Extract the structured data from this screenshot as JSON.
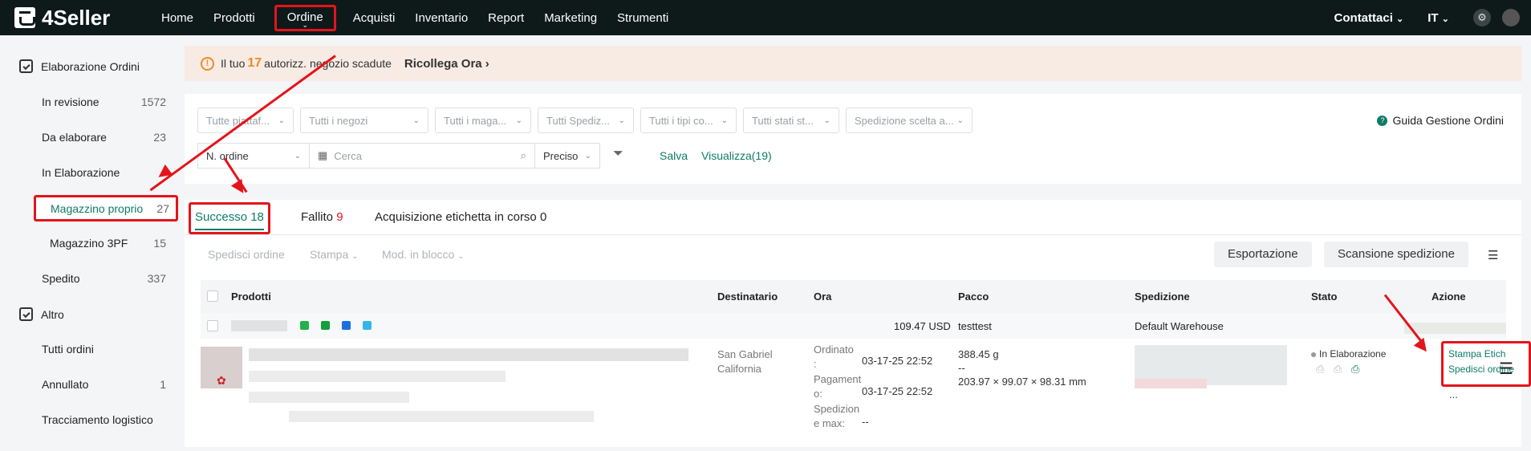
{
  "topbar": {
    "logo": "4Seller",
    "nav": [
      "Home",
      "Prodotti",
      "Ordine",
      "Acquisti",
      "Inventario",
      "Report",
      "Marketing",
      "Strumenti"
    ],
    "contact": "Contattaci",
    "lang": "IT"
  },
  "sidebar": {
    "section1": "Elaborazione Ordini",
    "items": [
      {
        "label": "In revisione",
        "count": "1572"
      },
      {
        "label": "Da elaborare",
        "count": "23"
      },
      {
        "label": "In Elaborazione",
        "count": ""
      },
      {
        "label": "Magazzino proprio",
        "count": "27"
      },
      {
        "label": "Magazzino 3PF",
        "count": "15"
      },
      {
        "label": "Spedito",
        "count": "337"
      }
    ],
    "section2": "Altro",
    "items2": [
      {
        "label": "Tutti ordini",
        "count": ""
      },
      {
        "label": "Annullato",
        "count": "1"
      },
      {
        "label": "Tracciamento logistico",
        "count": ""
      }
    ]
  },
  "alert": {
    "prefix": "Il tuo",
    "number": "17",
    "suffix": "autorizz. negozio scadute",
    "link": "Ricollega Ora"
  },
  "filters": {
    "selects": [
      "Tutte piattaf...",
      "Tutti i negozi",
      "Tutti i maga...",
      "Tutti Spediz...",
      "Tutti i tipi co...",
      "Tutti stati st...",
      "Spedizione scelta a..."
    ],
    "guide": "Guida Gestione Ordini",
    "order_field": "N. ordine",
    "search_placeholder": "Cerca",
    "match": "Preciso",
    "save": "Salva",
    "view": "Visualizza(19)"
  },
  "tabs": {
    "success_label": "Successo",
    "success_count": "18",
    "fail_label": "Fallito",
    "fail_count": "9",
    "acq_label": "Acquisizione etichetta in corso 0"
  },
  "actions": {
    "ship": "Spedisci ordine",
    "print": "Stampa",
    "bulk": "Mod. in blocco",
    "export": "Esportazione",
    "scan": "Scansione spedizione"
  },
  "table": {
    "headers": [
      "Prodotti",
      "Destinatario",
      "Ora",
      "Pacco",
      "Spedizione",
      "Stato",
      "Azione"
    ],
    "group": {
      "amount": "109.47 USD",
      "package": "testtest",
      "warehouse": "Default Warehouse"
    },
    "row": {
      "city": "San Gabriel",
      "state": "California",
      "ordered_label": "Ordinato",
      "ordered_sep": ":",
      "ordered_time": "03-17-25 22:52",
      "payment_label": "Pagament",
      "payment_label2": "o:",
      "payment_time": "03-17-25 22:52",
      "ship_label": "Spedizion",
      "ship_label2": "e max:",
      "ship_time": "--",
      "weight": "388.45 g",
      "dash": "--",
      "dims": "203.97 × 99.07 × 98.31 mm",
      "status": "In Elaborazione",
      "op_print": "Stampa Etich",
      "op_ship": "Spedisci ordine",
      "more": "..."
    }
  },
  "colors": {
    "accent": "#0e7c66",
    "highlight": "#e4141b",
    "warning": "#f08a24",
    "topbar": "#0e1a1a"
  }
}
